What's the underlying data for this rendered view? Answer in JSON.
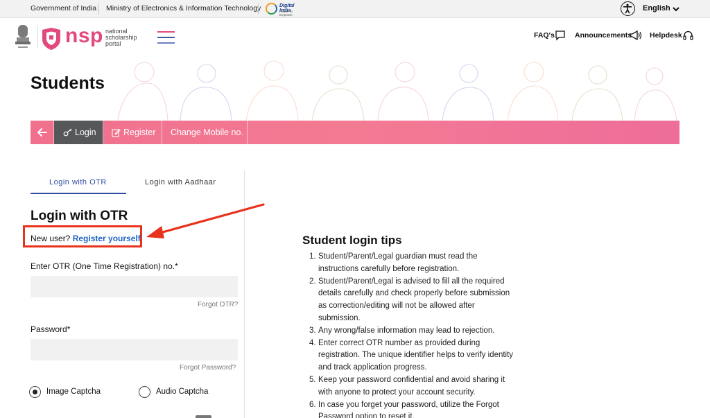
{
  "gov_bar": {
    "gov_india": "Government of India",
    "ministry": "Ministry of Electronics & Information Technology",
    "digital_india": "Digital India",
    "digital_india_tag": "Power To Empower",
    "language": "English"
  },
  "header": {
    "brand": "nsp",
    "brand_sub": "national scholarship portal",
    "links": [
      {
        "label": "FAQ's",
        "icon": "chat-icon"
      },
      {
        "label": "Announcements",
        "icon": "megaphone-icon"
      },
      {
        "label": "Helpdesk",
        "icon": "headset-icon"
      }
    ]
  },
  "hero": {
    "title": "Students"
  },
  "nav": {
    "tabs": [
      {
        "label": "Login",
        "icon": "key-icon",
        "active": true
      },
      {
        "label": "Register",
        "icon": "edit-icon",
        "active": false
      },
      {
        "label": "Change Mobile no.",
        "icon": "",
        "active": false
      }
    ]
  },
  "login": {
    "subtabs": [
      "Login with OTR",
      "Login with Aadhaar"
    ],
    "title": "Login with OTR",
    "new_user_prefix": "New user?",
    "register_link": "Register yourself",
    "otr_label": "Enter OTR (One Time Registration) no.*",
    "otr_value": "",
    "forgot_otr": "Forgot OTR?",
    "password_label": "Password*",
    "password_value": "",
    "forgot_password": "Forgot Password?",
    "captcha_options": [
      {
        "label": "Image Captcha",
        "checked": true
      },
      {
        "label": "Audio Captcha",
        "checked": false
      }
    ]
  },
  "tips": {
    "title": "Student login tips",
    "items": [
      "Student/Parent/Legal guardian must read the instructions carefully before registration.",
      "Student/Parent/Legal is advised to fill all the required details carefully and check properly before submission as correction/editing will not be allowed after submission.",
      "Any wrong/false information may lead to rejection.",
      "Enter correct OTR number as provided during registration. The unique identifier helps to verify identity and track application progress.",
      "Keep your password confidential and avoid sharing it with anyone to protect your account security.",
      "In case you forget your password, utilize the Forgot Password option to reset it."
    ]
  },
  "colors": {
    "brand_pink": "#e24a7b",
    "nav_active": "#555759",
    "link_blue": "#1e64c8",
    "highlight_red": "#e8321c"
  }
}
